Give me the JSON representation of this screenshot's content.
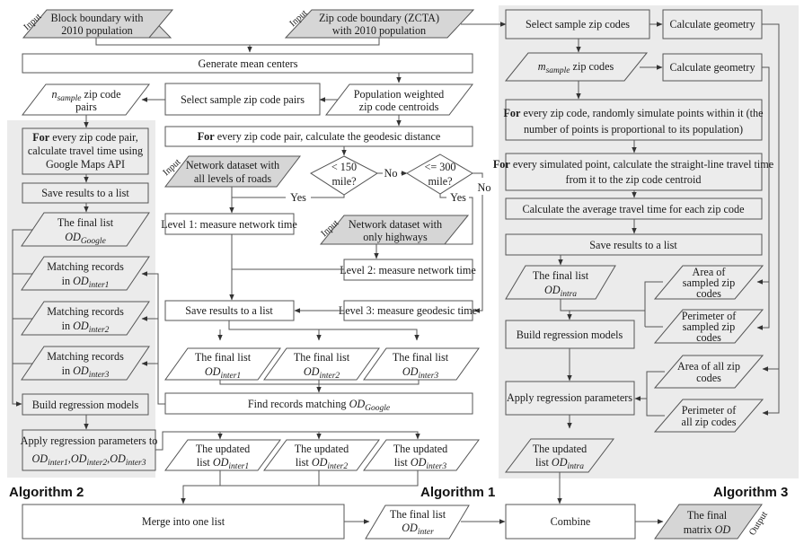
{
  "diagram": {
    "tags": {
      "input": "Input",
      "output": "Output"
    },
    "algorithms": {
      "alg1": "Algorithm 1",
      "alg2": "Algorithm 2",
      "alg3": "Algorithm 3"
    },
    "top": {
      "block_boundary": [
        "Block boundary with",
        "2010 population"
      ],
      "zip_boundary": [
        "Zip code boundary (ZCTA)",
        "with 2010 population"
      ],
      "generate_centers": "Generate mean centers",
      "n_sample_pre": "n",
      "n_sample_sub": "sample",
      "n_sample_post": " zip code",
      "n_sample_line2": "pairs",
      "select_pairs": "Select sample zip code pairs",
      "weighted_centroids": [
        "Population weighted",
        "zip code centroids"
      ]
    },
    "alg1": {
      "geodesic_bold": "For",
      "geodesic_rest": " every zip code pair, calculate the geodesic distance",
      "network_all": [
        "Network dataset with",
        "all levels of roads"
      ],
      "d150": [
        "< 150",
        "mile?"
      ],
      "d300": [
        "<= 300",
        "mile?"
      ],
      "no": "No",
      "yes": "Yes",
      "level1": "Level 1: measure network time",
      "network_hwy": [
        "Network dataset with",
        "only highways"
      ],
      "level2": "Level 2: measure network time",
      "level3": "Level 3: measure geodesic time",
      "save": "Save results to a list",
      "final_list": "The final list",
      "od": "OD",
      "inter1": "inter1",
      "inter2": "inter2",
      "inter3": "inter3",
      "find_pre": "Find records matching ",
      "google": "Google",
      "updated": "The updated",
      "list_pre": "list ",
      "merge": "Merge into one list",
      "inter": "inter"
    },
    "alg2": {
      "for_bold": "For",
      "for_rest": " every zip code pair,",
      "for_line2": "calculate travel time using",
      "for_line3": "Google Maps API",
      "save": "Save results to a list",
      "final_list": "The final list",
      "matching": "Matching records",
      "in_pre": "in ",
      "build": "Build regression models",
      "apply": "Apply regression parameters to"
    },
    "alg3": {
      "select": "Select sample zip codes",
      "calc_geom": "Calculate geometry",
      "m_pre": "m",
      "m_sub": "sample",
      "m_post": " zip codes",
      "simulate_bold": "For",
      "simulate_rest": " every zip code, randomly simulate points within it (the",
      "simulate_line2": "number of points is proportional to its population)",
      "straight_bold": "For",
      "straight_rest": " every simulated point, calculate the straight-line travel time",
      "straight_line2": "from it to the zip code centroid",
      "average": "Calculate the average travel time for each zip code",
      "save": "Save results to a list",
      "final_list": "The final list",
      "intra": "intra",
      "area_sampled": [
        "Area of",
        "sampled zip",
        "codes"
      ],
      "perim_sampled": [
        "Perimeter of",
        "sampled zip",
        "codes"
      ],
      "build": "Build regression models",
      "apply": "Apply regression parameters",
      "area_all": [
        "Area of all zip",
        "codes"
      ],
      "perim_all": [
        "Perimeter of",
        "all zip codes"
      ],
      "updated": "The updated",
      "list_pre": "list "
    },
    "bottom": {
      "combine": "Combine",
      "final_matrix": [
        "The final",
        "matrix "
      ],
      "od": "OD"
    }
  }
}
